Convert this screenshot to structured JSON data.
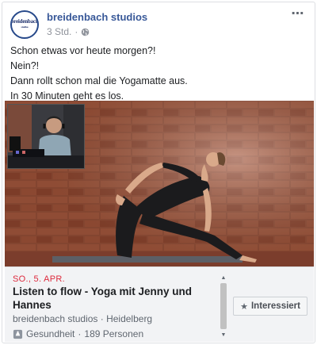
{
  "post": {
    "page_name": "breidenbach studios",
    "time": "3 Std.",
    "separator": "·",
    "avatar_text": "breidenbach",
    "avatar_sub": "studios",
    "more_icon": "⋯",
    "text_lines": [
      "Schon etwas vor heute morgen?!",
      "Nein?!",
      "Dann rollt schon mal die Yogamatte aus.",
      "In 30 Minuten geht es los."
    ]
  },
  "event": {
    "date": "SO., 5. APR.",
    "title": "Listen to flow - Yoga mit Jenny und Hannes",
    "location": "breidenbach studios · Heidelberg",
    "category": "Gesundheit",
    "people": "189 Personen",
    "stats_separator": "·",
    "interested_label": "Interessiert",
    "star_icon": "★"
  },
  "colors": {
    "link_blue": "#385898",
    "date_red": "#dd2a3d",
    "event_bg": "#f2f3f5"
  }
}
